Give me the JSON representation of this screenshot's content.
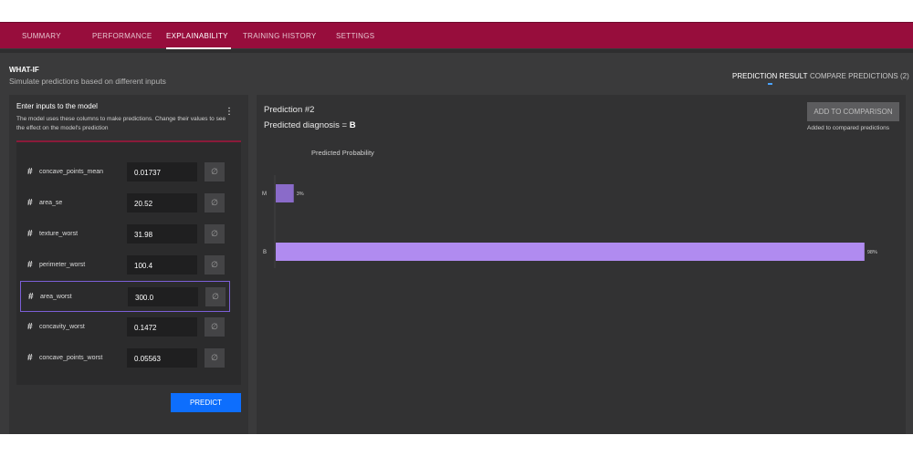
{
  "tabs": [
    {
      "label": "SUMMARY"
    },
    {
      "label": "PERFORMANCE"
    },
    {
      "label": "EXPLAINABILITY"
    },
    {
      "label": "TRAINING HISTORY"
    },
    {
      "label": "SETTINGS"
    }
  ],
  "active_tab": "EXPLAINABILITY",
  "header": {
    "title": "WHAT-IF",
    "subtitle": "Simulate predictions based on different inputs",
    "right_tabs": [
      {
        "label": "PREDICTION RESULT"
      },
      {
        "label": "COMPARE PREDICTIONS (2)"
      }
    ]
  },
  "inputs_panel": {
    "title": "Enter inputs to the model",
    "description": "The model uses these columns to make predictions. Change their values to see the effect on the model's prediction",
    "menu_icon": "kebab-menu-icon",
    "fields": [
      {
        "name": "concave_points_mean",
        "value": "0.01737"
      },
      {
        "name": "area_se",
        "value": "20.52"
      },
      {
        "name": "texture_worst",
        "value": "31.98"
      },
      {
        "name": "perimeter_worst",
        "value": "100.4"
      },
      {
        "name": "area_worst",
        "value": "300.0"
      },
      {
        "name": "concavity_worst",
        "value": "0.1472"
      },
      {
        "name": "concave_points_worst",
        "value": "0.05563"
      }
    ],
    "field_icon": "hash-icon",
    "clear_icon": "empty-set-icon",
    "predict_label": "PREDICT"
  },
  "result_panel": {
    "prediction_title": "Prediction #2",
    "diagnosis_prefix": "Predicted diagnosis = ",
    "diagnosis_value": "B",
    "add_button_label": "ADD TO COMPARISON",
    "added_note": "Added to compared predictions"
  },
  "chart_data": {
    "type": "bar",
    "orientation": "horizontal",
    "title": "Predicted Probability",
    "categories": [
      "M",
      "B"
    ],
    "values": [
      0.03,
      0.98
    ],
    "value_labels": [
      "3%",
      "98%"
    ],
    "xlim": [
      0,
      1
    ],
    "grid": false,
    "colors": {
      "M": "#8a6bc9",
      "B": "#b08bf0"
    }
  },
  "colors": {
    "brand": "#970d3c",
    "background": "#3a3a3b",
    "panel": "#323233",
    "primary_button": "#0d6efd",
    "highlight_border": "#7b5fd6"
  }
}
